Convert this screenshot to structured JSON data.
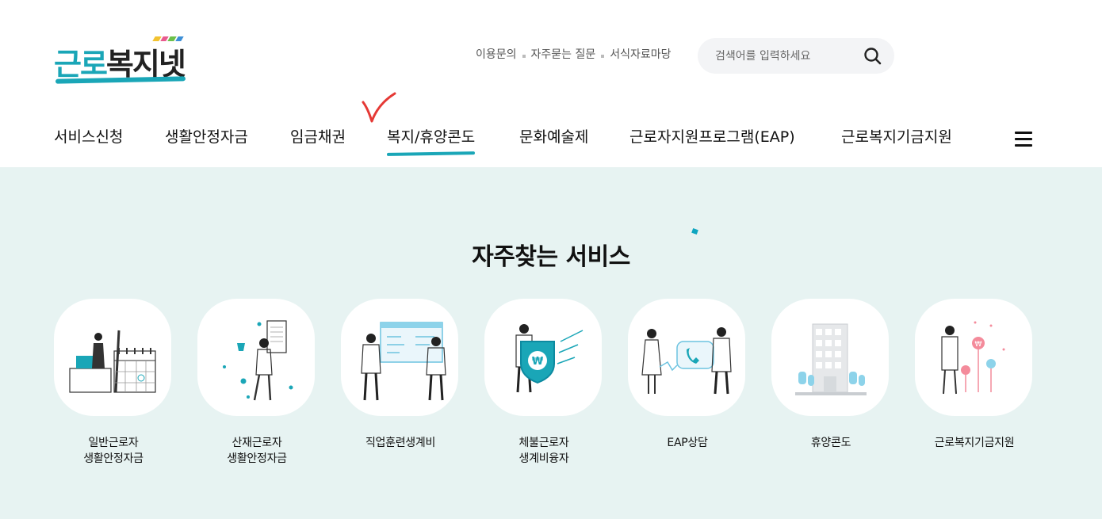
{
  "logo": {
    "part_a": "근로",
    "part_b": "복지넷"
  },
  "util_links": [
    {
      "label": "이용문의"
    },
    {
      "label": "자주묻는 질문"
    },
    {
      "label": "서식자료마당"
    }
  ],
  "search": {
    "placeholder": "검색어를 입력하세요",
    "value": ""
  },
  "gnb": [
    {
      "label": "서비스신청"
    },
    {
      "label": "생활안정자금"
    },
    {
      "label": "임금채권"
    },
    {
      "label": "복지/휴양콘도",
      "active": true
    },
    {
      "label": "문화예술제"
    },
    {
      "label": "근로자지원프로그램(EAP)"
    },
    {
      "label": "근로복지기금지원"
    }
  ],
  "main": {
    "title": "자주찾는 서비스",
    "services": [
      {
        "label": "일반근로자\n생활안정자금",
        "icon": "worker-calendar-icon"
      },
      {
        "label": "산재근로자\n생활안정자금",
        "icon": "worker-document-icon"
      },
      {
        "label": "직업훈련생계비",
        "icon": "training-board-icon"
      },
      {
        "label": "체불근로자\n생계비융자",
        "icon": "shield-won-icon"
      },
      {
        "label": "EAP상담",
        "icon": "phone-counsel-icon"
      },
      {
        "label": "휴양콘도",
        "icon": "condo-building-icon"
      },
      {
        "label": "근로복지기금지원",
        "icon": "fund-flower-icon"
      }
    ]
  },
  "colors": {
    "accent": "#1aa6b7",
    "bg_light": "#e7f3f2",
    "check_red": "#e53935"
  }
}
